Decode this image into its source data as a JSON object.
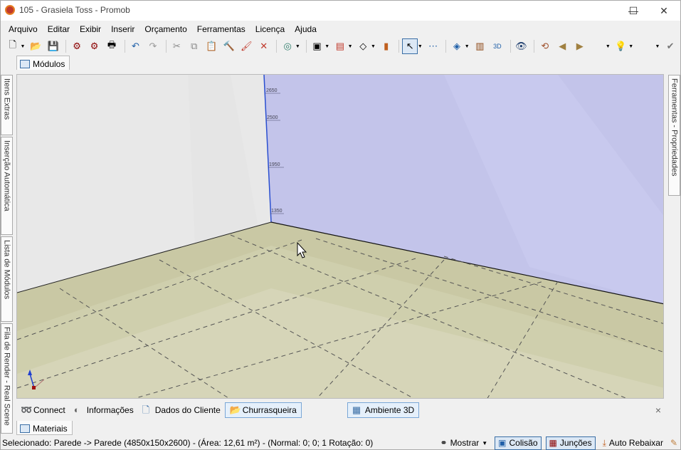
{
  "window": {
    "title": "105 - Grasiela Toss - Promob",
    "minimize": "—",
    "maximize": "☐",
    "close": "✕"
  },
  "menu": [
    "Arquivo",
    "Editar",
    "Exibir",
    "Inserir",
    "Orçamento",
    "Ferramentas",
    "Licença",
    "Ajuda"
  ],
  "toolbar_icons": [
    "new-icon",
    "open-icon",
    "save-icon",
    "render-icon",
    "render2-icon",
    "print-icon",
    "undo-icon",
    "redo-icon",
    "cut-icon",
    "copy-icon",
    "paste-icon",
    "hammer-icon",
    "paint-icon",
    "delete-icon",
    "globe-icon",
    "module-icon",
    "hierarchy-icon",
    "shape-icon",
    "door-icon",
    "select-arrow-icon",
    "measure-icon",
    "layers-icon",
    "book-icon",
    "3d-icon",
    "eye-icon",
    "rotate-icon",
    "nav-left-icon",
    "nav-right-icon",
    "light-icon",
    "check-icon"
  ],
  "document_tab": {
    "label": "Módulos"
  },
  "left_dock_tabs": [
    "Itens Extras",
    "Inserção Automática",
    "Lista de Módulos",
    "Fila de Render - Real Scene"
  ],
  "right_dock_tabs": [
    "Ferramentas - Propriedades"
  ],
  "viewport": {
    "ruler_marks": [
      "2650",
      "2500",
      "1950",
      "1350"
    ],
    "wall_color": "#c3c4ea",
    "floor_color": "#c9c8a4",
    "left_wall_color": "#e8e8e8"
  },
  "bottom_tabs": [
    {
      "label": "Connect",
      "icon": "connect-icon"
    },
    {
      "label": "Informações",
      "icon": "info-icon"
    },
    {
      "label": "Dados do Cliente",
      "icon": "document-icon"
    },
    {
      "label": "Churrasqueira",
      "icon": "folder-icon",
      "active": true
    },
    {
      "label": "Ambiente 3D",
      "icon": "ambient-icon",
      "active": true
    }
  ],
  "bottom_close": "×",
  "materials_tab": {
    "label": "Materiais"
  },
  "status": {
    "text": "Selecionado: Parede -> Parede (4850x150x2600) - (Área: 12,61 m²) - (Normal: 0; 0; 1 Rotação: 0)",
    "mostrar": "Mostrar",
    "colisao": "Colisão",
    "juncoes": "Junções",
    "auto_rebaixar": "Auto Rebaixar"
  }
}
